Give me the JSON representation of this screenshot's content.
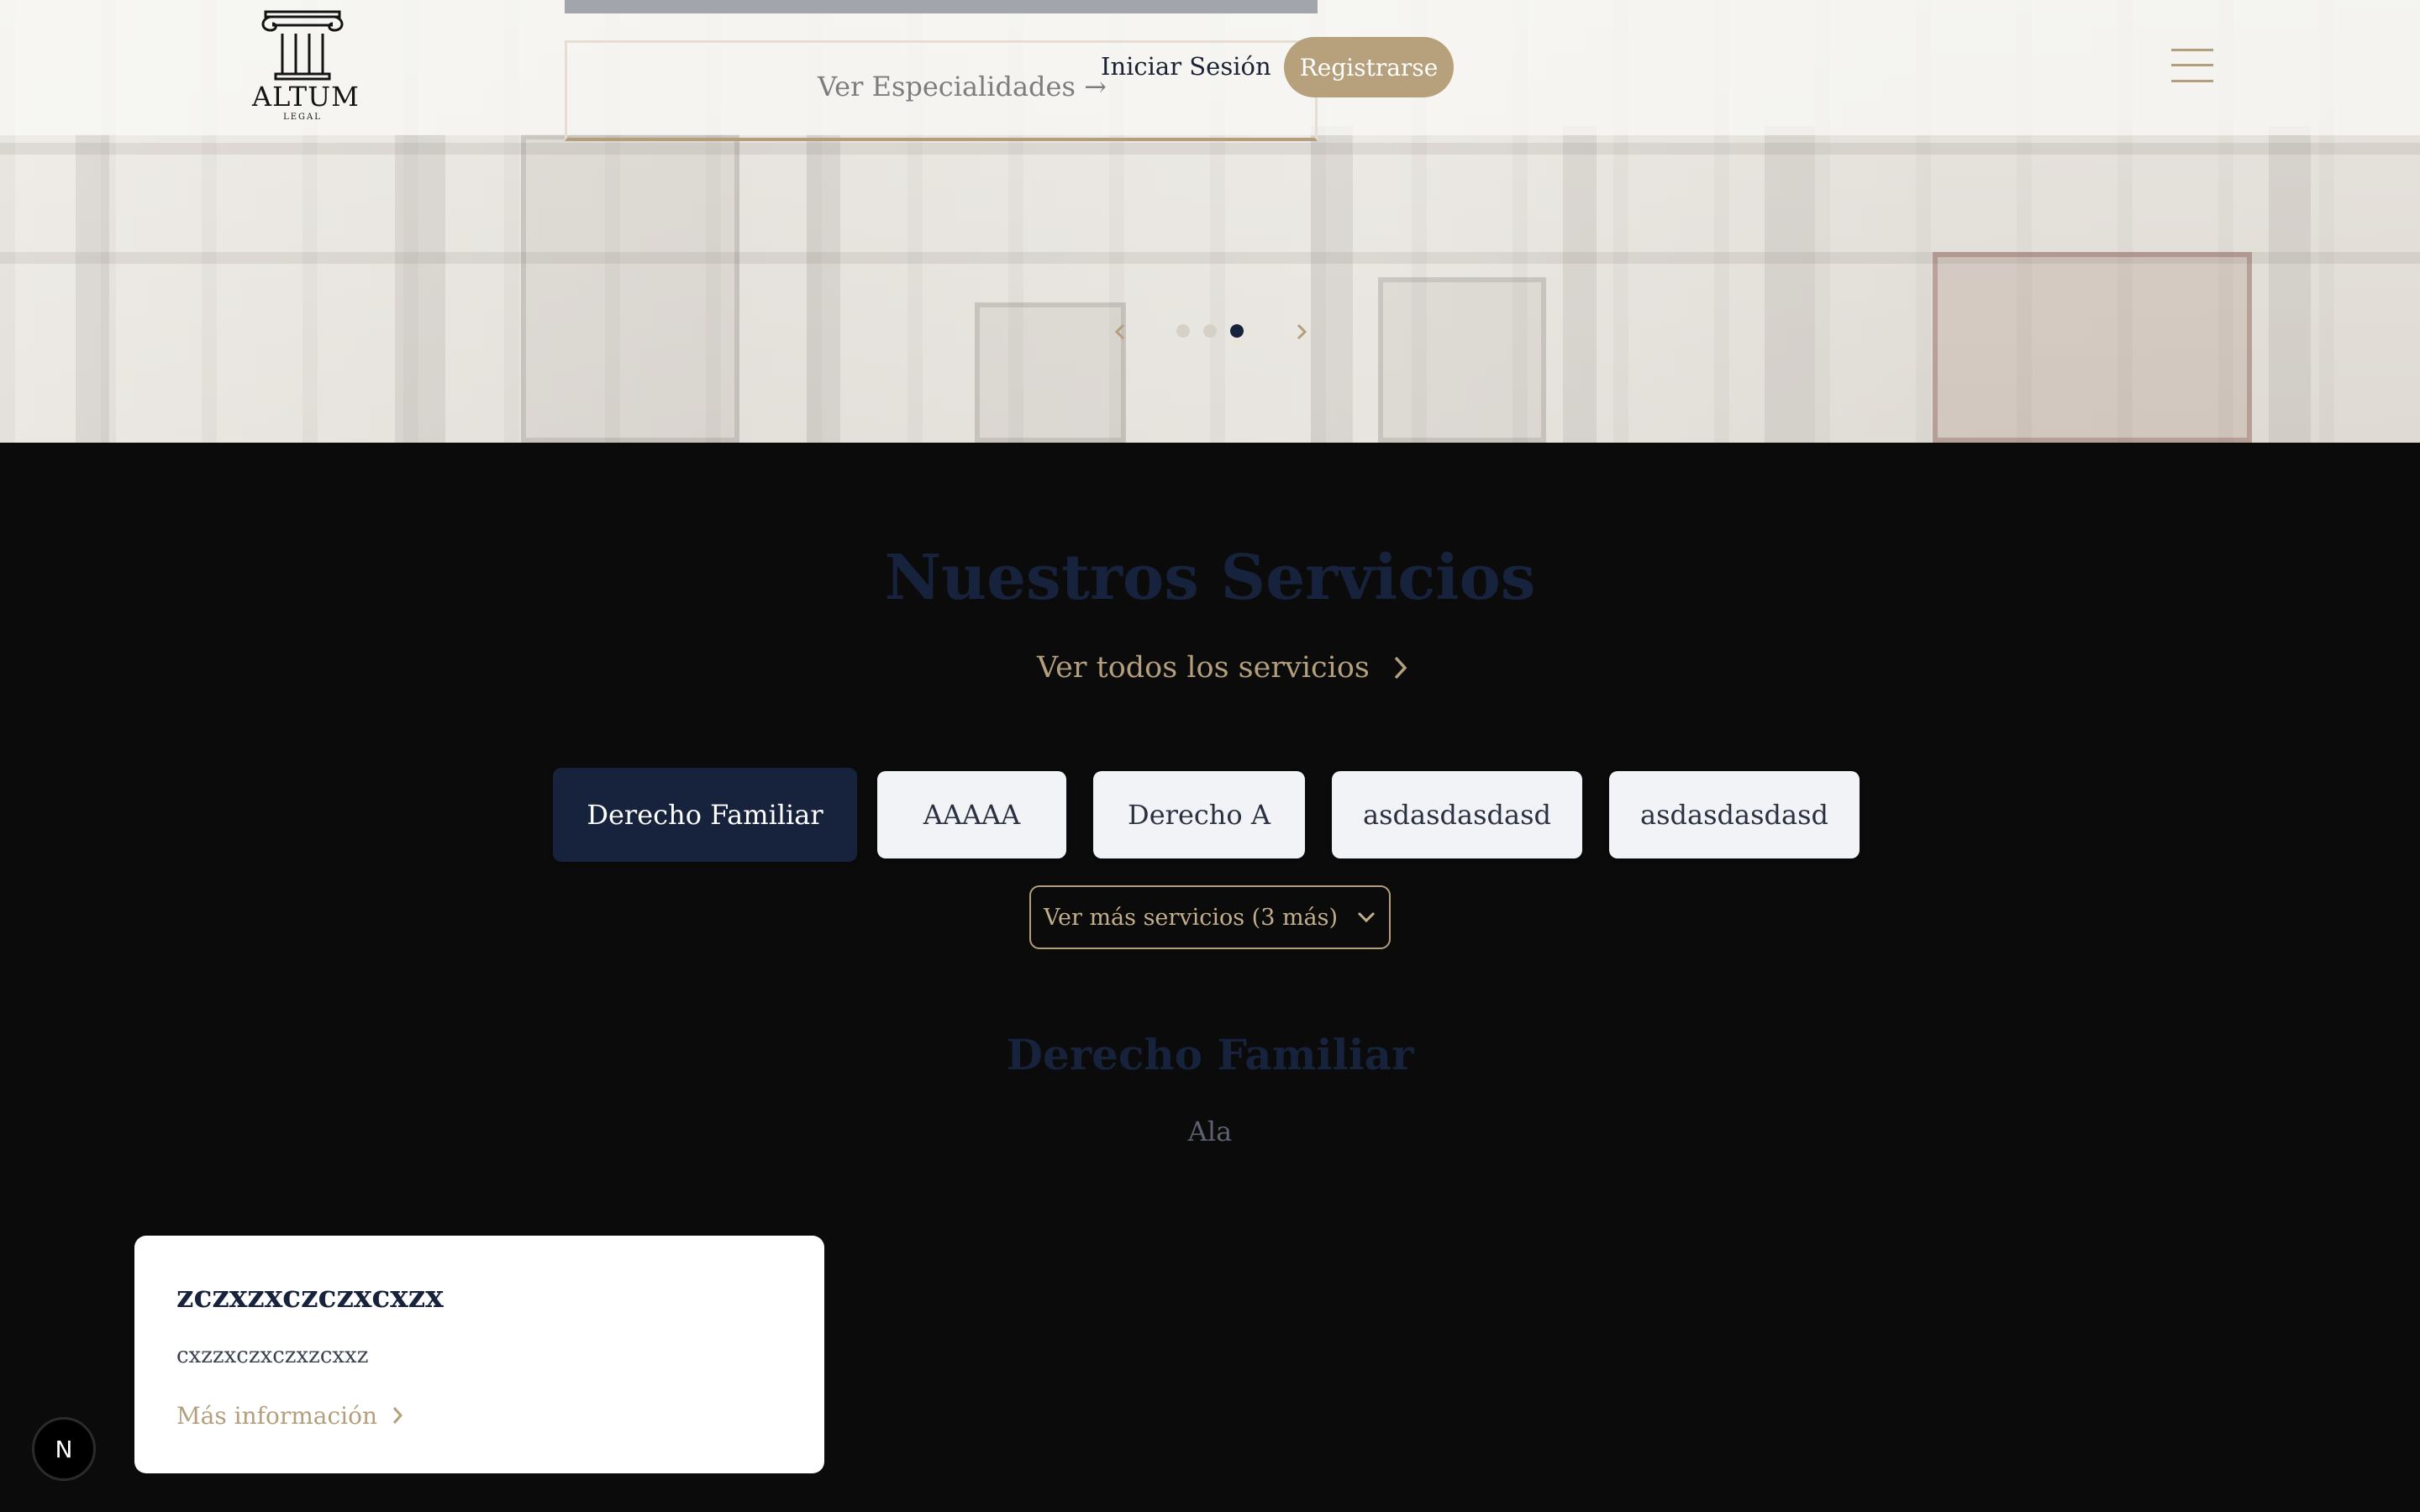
{
  "header": {
    "logo": {
      "name": "ALTUM",
      "sub": "LEGAL"
    },
    "nav": {
      "login_label": "Iniciar Sesión",
      "register_label": "Registrarse"
    }
  },
  "hero": {
    "cta_label": "Ver Especialidades →",
    "carousel": {
      "slide_count": 3,
      "active_index": 2
    }
  },
  "services": {
    "title": "Nuestros Servicios",
    "see_all_label": "Ver todos los servicios",
    "tabs": [
      {
        "label": "Derecho Familiar",
        "active": true
      },
      {
        "label": "AAAAA",
        "active": false
      },
      {
        "label": "Derecho A",
        "active": false
      },
      {
        "label": "asdasdasdasd",
        "active": false
      },
      {
        "label": "asdasdasdasd",
        "active": false
      }
    ],
    "more_label": "Ver más servicios (3 más)",
    "selected": {
      "title": "Derecho Familiar",
      "description": "Ala"
    },
    "card": {
      "title": "zczxzxczczxcxzx",
      "body": "cxzzxczxczxzcxxz",
      "link_label": "Más información"
    }
  },
  "dev_badge": {
    "label": "N"
  },
  "colors": {
    "navy": "#17223c",
    "gold": "#b49f7d",
    "dark_bg": "#0b0b0c"
  }
}
